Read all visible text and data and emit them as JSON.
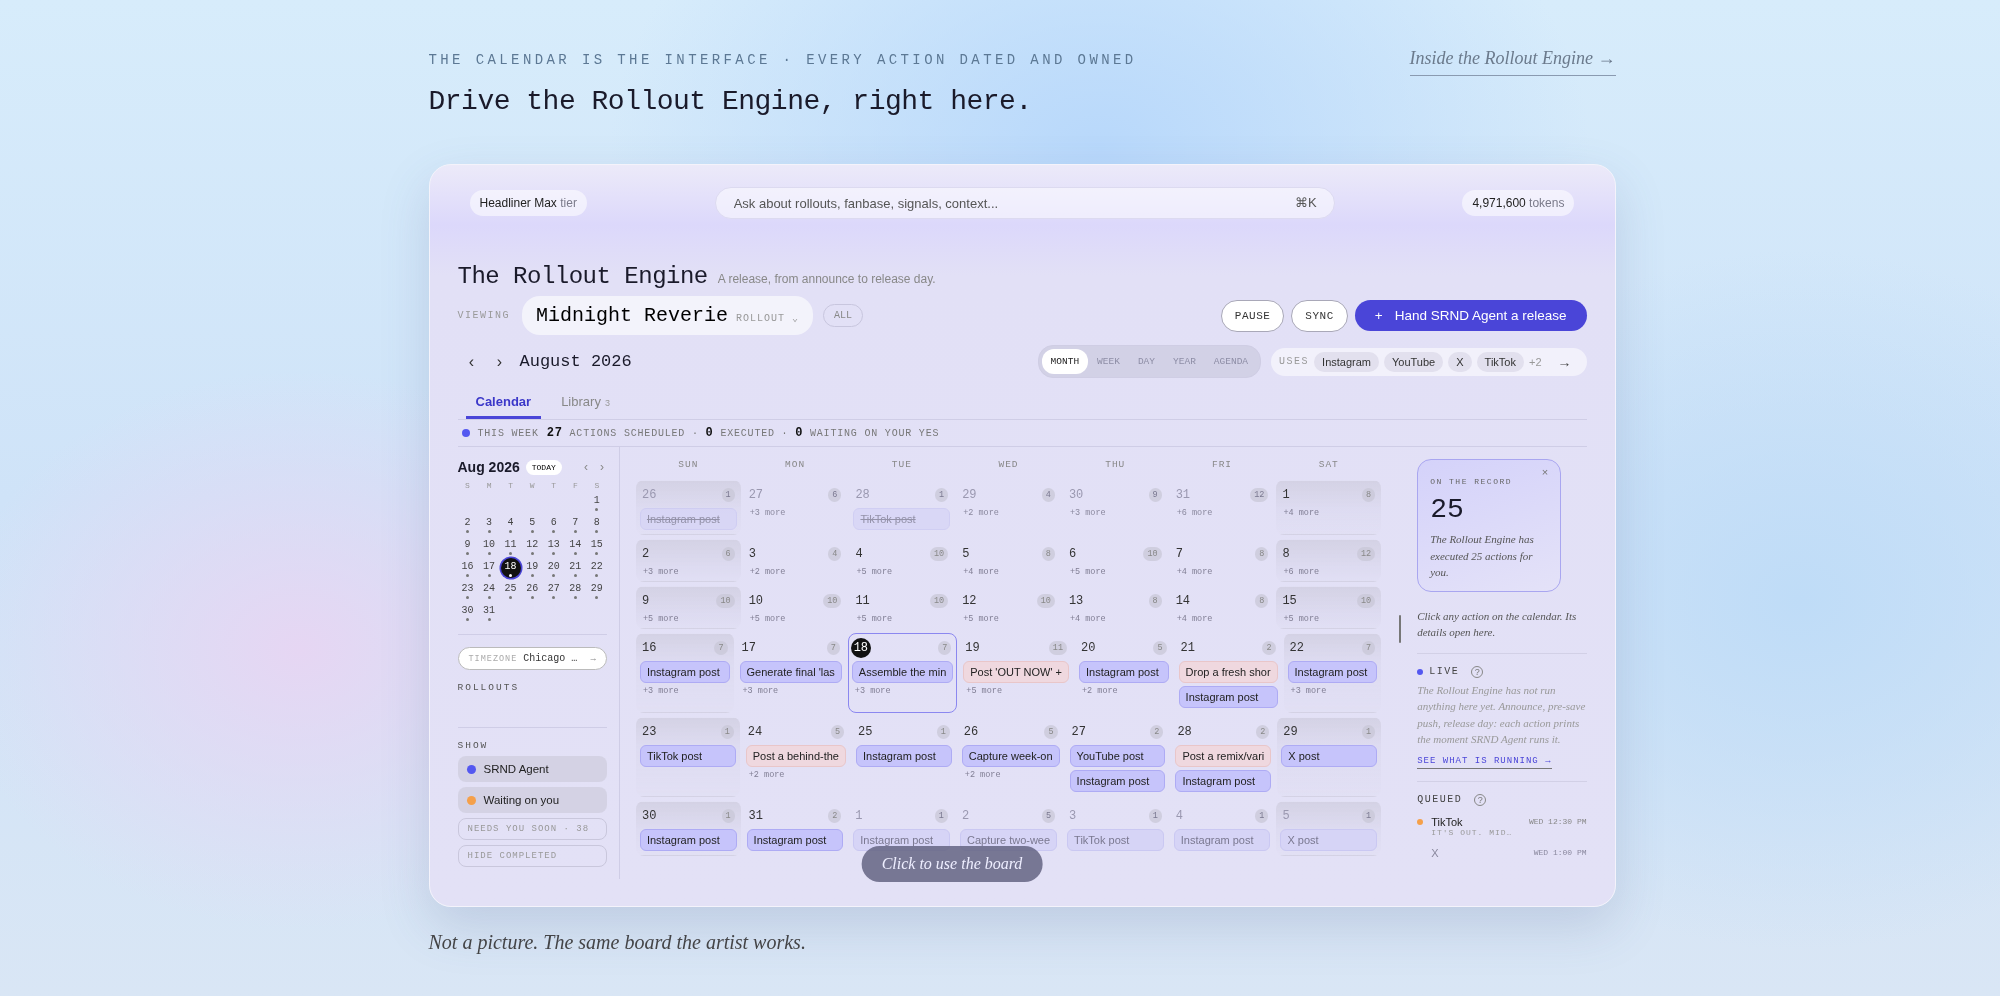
{
  "header": {
    "eyebrow": "THE CALENDAR IS THE INTERFACE · EVERY ACTION DATED AND OWNED",
    "title": "Drive the Rollout Engine, right here.",
    "link": "Inside the Rollout Engine →"
  },
  "app": {
    "topbar": {
      "tier": "**Headliner Max** tier",
      "search_placeholder": "Ask about rollouts, fanbase, signals, context...",
      "shortcut": "⌘K",
      "tokens": "**4,971,600** tokens"
    },
    "title": "The Rollout Engine",
    "subtitle": "A release, from announce to release day.",
    "viewing_label": "VIEWING",
    "rollout": {
      "name": "Midnight Reverie",
      "type": "ROLLOUT",
      "caret": "⌄"
    },
    "all_button": "ALL",
    "actions": [
      "PAUSE",
      "SYNC"
    ],
    "primary_action": {
      "icon": "+",
      "label": "Hand SRND Agent a release"
    },
    "month": {
      "prev": "‹",
      "next": "›",
      "label": "August 2026"
    },
    "views": [
      {
        "label": "MONTH",
        "selected": true
      },
      {
        "label": "WEEK",
        "selected": false
      },
      {
        "label": "DAY",
        "selected": false
      },
      {
        "label": "YEAR",
        "selected": false
      },
      {
        "label": "AGENDA",
        "selected": false
      }
    ],
    "uses": {
      "label": "USES",
      "platforms": [
        "Instagram",
        "YouTube",
        "X",
        "TikTok"
      ],
      "more": "+2",
      "arrow": "→"
    },
    "tabs": [
      {
        "label": "Calendar",
        "selected": true
      },
      {
        "label": "Library",
        "count": "3",
        "selected": false
      }
    ],
    "week_summary": {
      "label": "THIS WEEK",
      "text": "**27** ACTIONS SCHEDULED · **0** EXECUTED · **0** WAITING ON YOUR YES"
    },
    "mini_calendar": {
      "title": "Aug 2026",
      "today": "TODAY",
      "prev": "‹",
      "next": "›",
      "weekdays": [
        "S",
        "M",
        "T",
        "W",
        "T",
        "F",
        "S"
      ],
      "weeks": [
        [
          {
            "day": "1",
            "selected": false
          }
        ],
        [
          {
            "day": "2",
            "selected": false
          },
          {
            "day": "3",
            "selected": false
          },
          {
            "day": "4",
            "selected": false
          },
          {
            "day": "5",
            "selected": false
          },
          {
            "day": "6",
            "selected": false
          },
          {
            "day": "7",
            "selected": false
          },
          {
            "day": "8",
            "selected": false
          }
        ],
        [
          {
            "day": "9",
            "selected": false
          },
          {
            "day": "10",
            "selected": false
          },
          {
            "day": "11",
            "selected": false
          },
          {
            "day": "12",
            "selected": false
          },
          {
            "day": "13",
            "selected": false
          },
          {
            "day": "14",
            "selected": false
          },
          {
            "day": "15",
            "selected": false
          }
        ],
        [
          {
            "day": "16",
            "selected": false
          },
          {
            "day": "17",
            "selected": false
          },
          {
            "day": "18",
            "selected": true
          },
          {
            "day": "19",
            "selected": false
          },
          {
            "day": "20",
            "selected": false
          },
          {
            "day": "21",
            "selected": false
          },
          {
            "day": "22",
            "selected": false
          }
        ],
        [
          {
            "day": "23",
            "selected": false
          },
          {
            "day": "24",
            "selected": false
          },
          {
            "day": "25",
            "selected": false
          },
          {
            "day": "26",
            "selected": false
          },
          {
            "day": "27",
            "selected": false
          },
          {
            "day": "28",
            "selected": false
          },
          {
            "day": "29",
            "selected": false
          }
        ],
        [
          {
            "day": "30",
            "selected": false
          },
          {
            "day": "31",
            "selected": false
          }
        ]
      ]
    },
    "timezone": {
      "label": "TIMEZONE",
      "value": "Chicago …",
      "arrow": "→"
    },
    "rollouts_heading": "ROLLOUTS",
    "show_heading": "SHOW",
    "filters": [
      {
        "label": "SRND Agent",
        "color": "#5458f0"
      },
      {
        "label": "Waiting on you",
        "color": "#f5a04a"
      }
    ],
    "toggles": [
      "NEEDS YOU SOON · 38",
      "HIDE COMPLETED"
    ],
    "calendar": {
      "weekdays": [
        "SUN",
        "MON",
        "TUE",
        "WED",
        "THU",
        "FRI",
        "SAT"
      ],
      "weeks": [
        [
          {
            "day": "26",
            "count": "1",
            "muted": true,
            "selected": false,
            "events": [
              {
                "title": "Instagram post",
                "kind": "agent",
                "done": true
              }
            ]
          },
          {
            "day": "27",
            "count": "6",
            "muted": true,
            "selected": false,
            "more": "+3 more"
          },
          {
            "day": "28",
            "count": "1",
            "muted": true,
            "selected": false,
            "events": [
              {
                "title": "TikTok post",
                "kind": "agent",
                "done": true
              }
            ]
          },
          {
            "day": "29",
            "count": "4",
            "muted": true,
            "selected": false,
            "more": "+2 more"
          },
          {
            "day": "30",
            "count": "9",
            "muted": true,
            "selected": false,
            "more": "+3 more"
          },
          {
            "day": "31",
            "count": "12",
            "muted": true,
            "selected": false,
            "more": "+6 more"
          },
          {
            "day": "1",
            "count": "8",
            "muted": false,
            "selected": false,
            "more": "+4 more"
          }
        ],
        [
          {
            "day": "2",
            "count": "6",
            "muted": false,
            "selected": false,
            "more": "+3 more"
          },
          {
            "day": "3",
            "count": "4",
            "muted": false,
            "selected": false,
            "more": "+2 more"
          },
          {
            "day": "4",
            "count": "10",
            "muted": false,
            "selected": false,
            "more": "+5 more"
          },
          {
            "day": "5",
            "count": "8",
            "muted": false,
            "selected": false,
            "more": "+4 more"
          },
          {
            "day": "6",
            "count": "10",
            "muted": false,
            "selected": false,
            "more": "+5 more"
          },
          {
            "day": "7",
            "count": "8",
            "muted": false,
            "selected": false,
            "more": "+4 more"
          },
          {
            "day": "8",
            "count": "12",
            "muted": false,
            "selected": false,
            "more": "+6 more"
          }
        ],
        [
          {
            "day": "9",
            "count": "10",
            "muted": false,
            "selected": false,
            "more": "+5 more"
          },
          {
            "day": "10",
            "count": "10",
            "muted": false,
            "selected": false,
            "more": "+5 more"
          },
          {
            "day": "11",
            "count": "10",
            "muted": false,
            "selected": false,
            "more": "+5 more"
          },
          {
            "day": "12",
            "count": "10",
            "muted": false,
            "selected": false,
            "more": "+5 more"
          },
          {
            "day": "13",
            "count": "8",
            "muted": false,
            "selected": false,
            "more": "+4 more"
          },
          {
            "day": "14",
            "count": "8",
            "muted": false,
            "selected": false,
            "more": "+4 more"
          },
          {
            "day": "15",
            "count": "10",
            "muted": false,
            "selected": false,
            "more": "+5 more"
          }
        ],
        [
          {
            "day": "16",
            "count": "7",
            "muted": false,
            "selected": false,
            "events": [
              {
                "title": "Instagram post",
                "kind": "agent",
                "done": false
              }
            ],
            "more": "+3 more"
          },
          {
            "day": "17",
            "count": "7",
            "muted": false,
            "selected": false,
            "events": [
              {
                "title": "Generate final 'las",
                "kind": "agent",
                "done": false
              }
            ],
            "more": "+3 more"
          },
          {
            "day": "18",
            "count": "7",
            "muted": false,
            "selected": true,
            "events": [
              {
                "title": "Assemble the min",
                "kind": "agent",
                "done": false
              }
            ],
            "more": "+3 more"
          },
          {
            "day": "19",
            "count": "11",
            "muted": false,
            "selected": false,
            "events": [
              {
                "title": "Post 'OUT NOW' +",
                "kind": "waiting",
                "done": false
              }
            ],
            "more": "+5 more"
          },
          {
            "day": "20",
            "count": "5",
            "muted": false,
            "selected": false,
            "events": [
              {
                "title": "Instagram post",
                "kind": "agent",
                "done": false
              }
            ],
            "more": "+2 more"
          },
          {
            "day": "21",
            "count": "2",
            "muted": false,
            "selected": false,
            "events": [
              {
                "title": "Drop a fresh shor",
                "kind": "waiting",
                "done": false
              },
              {
                "title": "Instagram post",
                "kind": "agent",
                "done": false
              }
            ]
          },
          {
            "day": "22",
            "count": "7",
            "muted": false,
            "selected": false,
            "events": [
              {
                "title": "Instagram post",
                "kind": "agent",
                "done": false
              }
            ],
            "more": "+3 more"
          }
        ],
        [
          {
            "day": "23",
            "count": "1",
            "muted": false,
            "selected": false,
            "events": [
              {
                "title": "TikTok post",
                "kind": "agent",
                "done": false
              }
            ]
          },
          {
            "day": "24",
            "count": "5",
            "muted": false,
            "selected": false,
            "events": [
              {
                "title": "Post a behind-the",
                "kind": "waiting",
                "done": false
              }
            ],
            "more": "+2 more"
          },
          {
            "day": "25",
            "count": "1",
            "muted": false,
            "selected": false,
            "events": [
              {
                "title": "Instagram post",
                "kind": "agent",
                "done": false
              }
            ]
          },
          {
            "day": "26",
            "count": "5",
            "muted": false,
            "selected": false,
            "events": [
              {
                "title": "Capture week-on",
                "kind": "agent",
                "done": false
              }
            ],
            "more": "+2 more"
          },
          {
            "day": "27",
            "count": "2",
            "muted": false,
            "selected": false,
            "events": [
              {
                "title": "YouTube post",
                "kind": "agent",
                "done": false
              },
              {
                "title": "Instagram post",
                "kind": "agent",
                "done": false
              }
            ]
          },
          {
            "day": "28",
            "count": "2",
            "muted": false,
            "selected": false,
            "events": [
              {
                "title": "Post a remix/vari",
                "kind": "waiting",
                "done": false
              },
              {
                "title": "Instagram post",
                "kind": "agent",
                "done": false
              }
            ]
          },
          {
            "day": "29",
            "count": "1",
            "muted": false,
            "selected": false,
            "events": [
              {
                "title": "X post",
                "kind": "agent",
                "done": false
              }
            ]
          }
        ],
        [
          {
            "day": "30",
            "count": "1",
            "muted": false,
            "selected": false,
            "events": [
              {
                "title": "Instagram post",
                "kind": "agent",
                "done": false
              }
            ]
          },
          {
            "day": "31",
            "count": "2",
            "muted": false,
            "selected": false,
            "events": [
              {
                "title": "Instagram post",
                "kind": "agent",
                "done": false
              }
            ]
          },
          {
            "day": "1",
            "count": "1",
            "muted": true,
            "selected": false,
            "events": [
              {
                "title": "Instagram post",
                "kind": "agent",
                "done": false
              }
            ]
          },
          {
            "day": "2",
            "count": "5",
            "muted": true,
            "selected": false,
            "events": [
              {
                "title": "Capture two-wee",
                "kind": "agent",
                "done": false
              }
            ]
          },
          {
            "day": "3",
            "count": "1",
            "muted": true,
            "selected": false,
            "events": [
              {
                "title": "TikTok post",
                "kind": "agent",
                "done": false
              }
            ]
          },
          {
            "day": "4",
            "count": "1",
            "muted": true,
            "selected": false,
            "events": [
              {
                "title": "Instagram post",
                "kind": "agent",
                "done": false
              }
            ]
          },
          {
            "day": "5",
            "count": "1",
            "muted": true,
            "selected": false,
            "events": [
              {
                "title": "X post",
                "kind": "agent",
                "done": false
              }
            ]
          }
        ]
      ]
    },
    "record": {
      "label": "ON THE RECORD",
      "close": "×",
      "value": "25",
      "text": "The Rollout Engine has executed 25 actions for you."
    },
    "hint": "Click any action on the calendar. Its details open here.",
    "live": {
      "label": "LIVE",
      "help": "?",
      "text": "The Rollout Engine has not run anything here yet. Announce, pre-save push, release day: each action prints the moment SRND Agent runs it.",
      "link": "SEE WHAT IS RUNNING →"
    },
    "queued": {
      "label": "QUEUED",
      "help": "?",
      "items": [
        {
          "title": "TikTok",
          "time": "WED 12:30 PM",
          "detail": "IT'S OUT. MID…",
          "color": "#f5a04a",
          "faded": false
        },
        {
          "title": "X",
          "time": "WED 1:00 PM",
          "faded": true
        }
      ]
    },
    "overlay": "Click to use the board"
  },
  "caption": "Not a picture. The same board the artist works."
}
